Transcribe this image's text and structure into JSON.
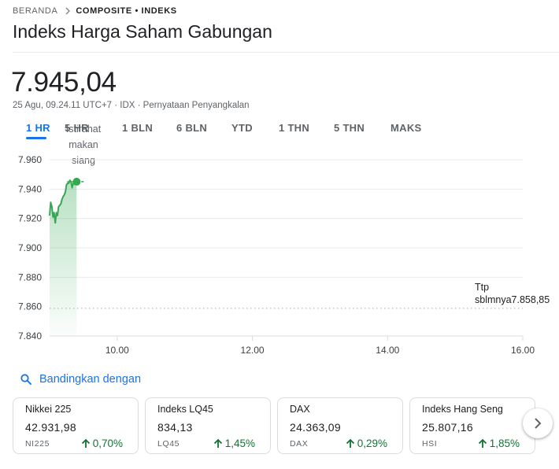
{
  "breadcrumb": {
    "home": "BERANDA",
    "current": "COMPOSITE • INDEKS"
  },
  "title": "Indeks Harga Saham Gabungan",
  "price": "7.945,04",
  "meta": "25 Agu, 09.24.11 UTC+7 · IDX · Pernyataan Penyangkalan",
  "ranges": [
    {
      "label": "1 HR",
      "active": true
    },
    {
      "label": "5 HR",
      "active": false
    },
    {
      "label": "1 BLN",
      "active": false
    },
    {
      "label": "6 BLN",
      "active": false
    },
    {
      "label": "YTD",
      "active": false
    },
    {
      "label": "1 THN",
      "active": false
    },
    {
      "label": "5 THN",
      "active": false
    },
    {
      "label": "MAKS",
      "active": false
    }
  ],
  "break_label": "Istirahat makan siang",
  "prev_close": {
    "label_line1": "Ttp",
    "label_line2": "sblmnya7.858,85",
    "value": 7858.85
  },
  "colors": {
    "accent": "#1a73e8",
    "positive": "#137333",
    "series": "#34a853"
  },
  "chart_data": {
    "type": "line",
    "x_unit": "time",
    "x": [
      "09.00",
      "09.01",
      "09.02",
      "09.03",
      "09.04",
      "09.05",
      "09.06",
      "09.07",
      "09.08",
      "09.09",
      "09.10",
      "09.11",
      "09.12",
      "09.13",
      "09.14",
      "09.15",
      "09.16",
      "09.17",
      "09.18",
      "09.19",
      "09.20",
      "09.21",
      "09.22",
      "09.23",
      "09.24"
    ],
    "values": [
      7922,
      7931,
      7928,
      7921,
      7924,
      7917,
      7924,
      7922,
      7928,
      7929,
      7930,
      7933,
      7935,
      7936,
      7938,
      7943,
      7944,
      7944,
      7946,
      7945,
      7941,
      7944,
      7944,
      7945,
      7945.04
    ],
    "last_value": 7945.04,
    "y_ticks": [
      "7.960",
      "7.940",
      "7.920",
      "7.900",
      "7.880",
      "7.860",
      "7.840"
    ],
    "y_tick_values": [
      7960,
      7940,
      7920,
      7900,
      7880,
      7860,
      7840
    ],
    "ylim": [
      7840,
      7960
    ],
    "x_ticks": [
      "10.00",
      "12.00",
      "14.00",
      "16.00"
    ],
    "x_tick_hours": [
      10,
      12,
      14,
      16
    ],
    "xlim_hours": [
      9,
      16
    ],
    "grid": true
  },
  "compare_label": "Bandingkan dengan",
  "cards": [
    {
      "name": "Nikkei 225",
      "value": "42.931,98",
      "symbol": "NI225",
      "change": "0,70%"
    },
    {
      "name": "Indeks LQ45",
      "value": "834,13",
      "symbol": "LQ45",
      "change": "1,45%"
    },
    {
      "name": "DAX",
      "value": "24.363,09",
      "symbol": "DAX",
      "change": "0,29%"
    },
    {
      "name": "Indeks Hang Seng",
      "value": "25.807,16",
      "symbol": "HSI",
      "change": "1,85%"
    }
  ],
  "icons": {
    "compare": "search-icon",
    "next": "chevron-right-icon",
    "breadcrumb_sep": "chevron-right-icon",
    "change": "arrow-up-icon"
  }
}
